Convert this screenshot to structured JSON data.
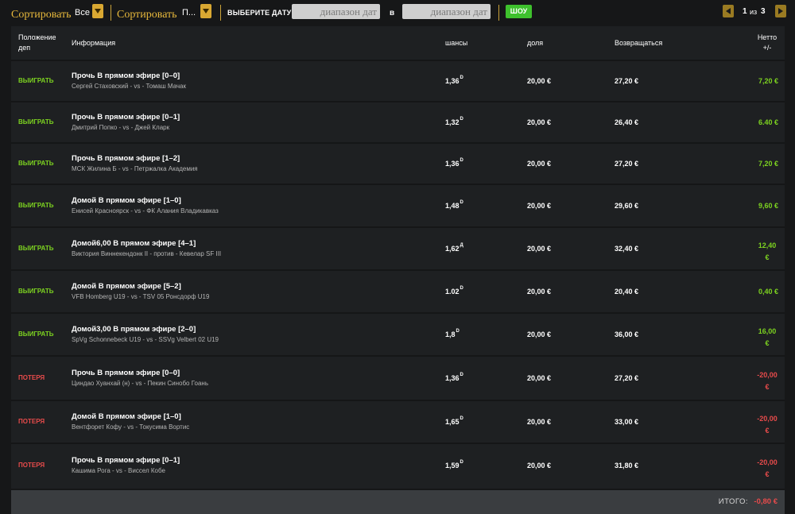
{
  "filters": {
    "sort1_label": "Сортировать",
    "sort1_value": "Все",
    "sort2_label": "Сортировать",
    "sort2_value": "П...",
    "date_label": "ВЫБЕРИТЕ ДАТУ",
    "date_from_placeholder": "диапазон дат",
    "date_sep": "в",
    "date_to_placeholder": "диапазон дат",
    "show_label": "ШОУ"
  },
  "pager": {
    "current": "1",
    "of": "из",
    "total": "3"
  },
  "columns": {
    "status": "Положение деп",
    "info": "Информация",
    "odds": "шансы",
    "stake": "доля",
    "return": "Возвращаться",
    "net": "Нетто +/-"
  },
  "bets": [
    {
      "status": "ВЫИГРАТЬ",
      "result": "win",
      "title": "Прочь В прямом эфире [0–0]",
      "teams": "Сергей Стаховский - vs - Томаш Мачак",
      "odds": "1,36",
      "odds_suffix": "D",
      "stake": "20,00 €",
      "return": "27,20 €",
      "net": "7,20 €"
    },
    {
      "status": "ВЫИГРАТЬ",
      "result": "win",
      "title": "Прочь В прямом эфире [0–1]",
      "teams": "Дмитрий Попко - vs - Джей Кларк",
      "odds": "1,32",
      "odds_suffix": "D",
      "stake": "20,00 €",
      "return": "26,40 €",
      "net": "6.40 €"
    },
    {
      "status": "ВЫИГРАТЬ",
      "result": "win",
      "title": "Прочь В прямом эфире [1–2]",
      "teams": "МСК Жилина Б - vs - Петржалка Академия",
      "odds": "1,36",
      "odds_suffix": "D",
      "stake": "20,00 €",
      "return": "27,20 €",
      "net": "7,20 €"
    },
    {
      "status": "ВЫИГРАТЬ",
      "result": "win",
      "title": "Домой В прямом эфире [1–0]",
      "teams": "Енисей Красноярск - vs - ФК Алания Владикавказ",
      "odds": "1,48",
      "odds_suffix": "D",
      "stake": "20,00 €",
      "return": "29,60 €",
      "net": "9,60 €"
    },
    {
      "status": "ВЫИГРАТЬ",
      "result": "win",
      "title": "Домой6,00 В прямом эфире [4–1]",
      "teams": "Виктория Виннекендонк II - против - Кевелар SF III",
      "odds": "1,62",
      "odds_suffix": "Д",
      "stake": "20,00 €",
      "return": "32,40 €",
      "net": "12,40 €"
    },
    {
      "status": "ВЫИГРАТЬ",
      "result": "win",
      "title": "Домой В прямом эфире [5–2]",
      "teams": "VFB Homberg U19 - vs - TSV 05 Ронсдорф U19",
      "odds": "1.02",
      "odds_suffix": "D",
      "stake": "20,00 €",
      "return": "20,40 €",
      "net": "0,40 €"
    },
    {
      "status": "ВЫИГРАТЬ",
      "result": "win",
      "title": "Домой3,00 В прямом эфире [2–0]",
      "teams": "SpVg Schonnebeck U19 - vs - SSVg Velbert 02 U19",
      "odds": "1,8",
      "odds_suffix": "D",
      "stake": "20,00 €",
      "return": "36,00 €",
      "net": "16,00 €"
    },
    {
      "status": "ПОТЕРЯ",
      "result": "lose",
      "title": "Прочь В прямом эфире [0–0]",
      "teams": "Циндао Хуанхай (н) - vs - Пекин Синобо Гоань",
      "odds": "1,36",
      "odds_suffix": "D",
      "stake": "20,00 €",
      "return": "27,20 €",
      "net": "-20,00 €"
    },
    {
      "status": "ПОТЕРЯ",
      "result": "lose",
      "title": "Домой В прямом эфире [1–0]",
      "teams": "Вентфорет Кофу - vs - Токусима Вортис",
      "odds": "1,65",
      "odds_suffix": "D",
      "stake": "20,00 €",
      "return": "33,00 €",
      "net": "-20,00 €"
    },
    {
      "status": "ПОТЕРЯ",
      "result": "lose",
      "title": "Прочь В прямом эфире [0–1]",
      "teams": "Кашима Рога - vs - Виссел Кобе",
      "odds": "1,59",
      "odds_suffix": "D",
      "stake": "20,00 €",
      "return": "31,80 €",
      "net": "-20,00 €"
    }
  ],
  "footer": {
    "total_label": "ИТОГО:",
    "total_value": "-0,80 €"
  },
  "colors": {
    "win": "#7dd320",
    "lose": "#e84b4b",
    "accent": "#d9a832",
    "show": "#3ec12d"
  }
}
